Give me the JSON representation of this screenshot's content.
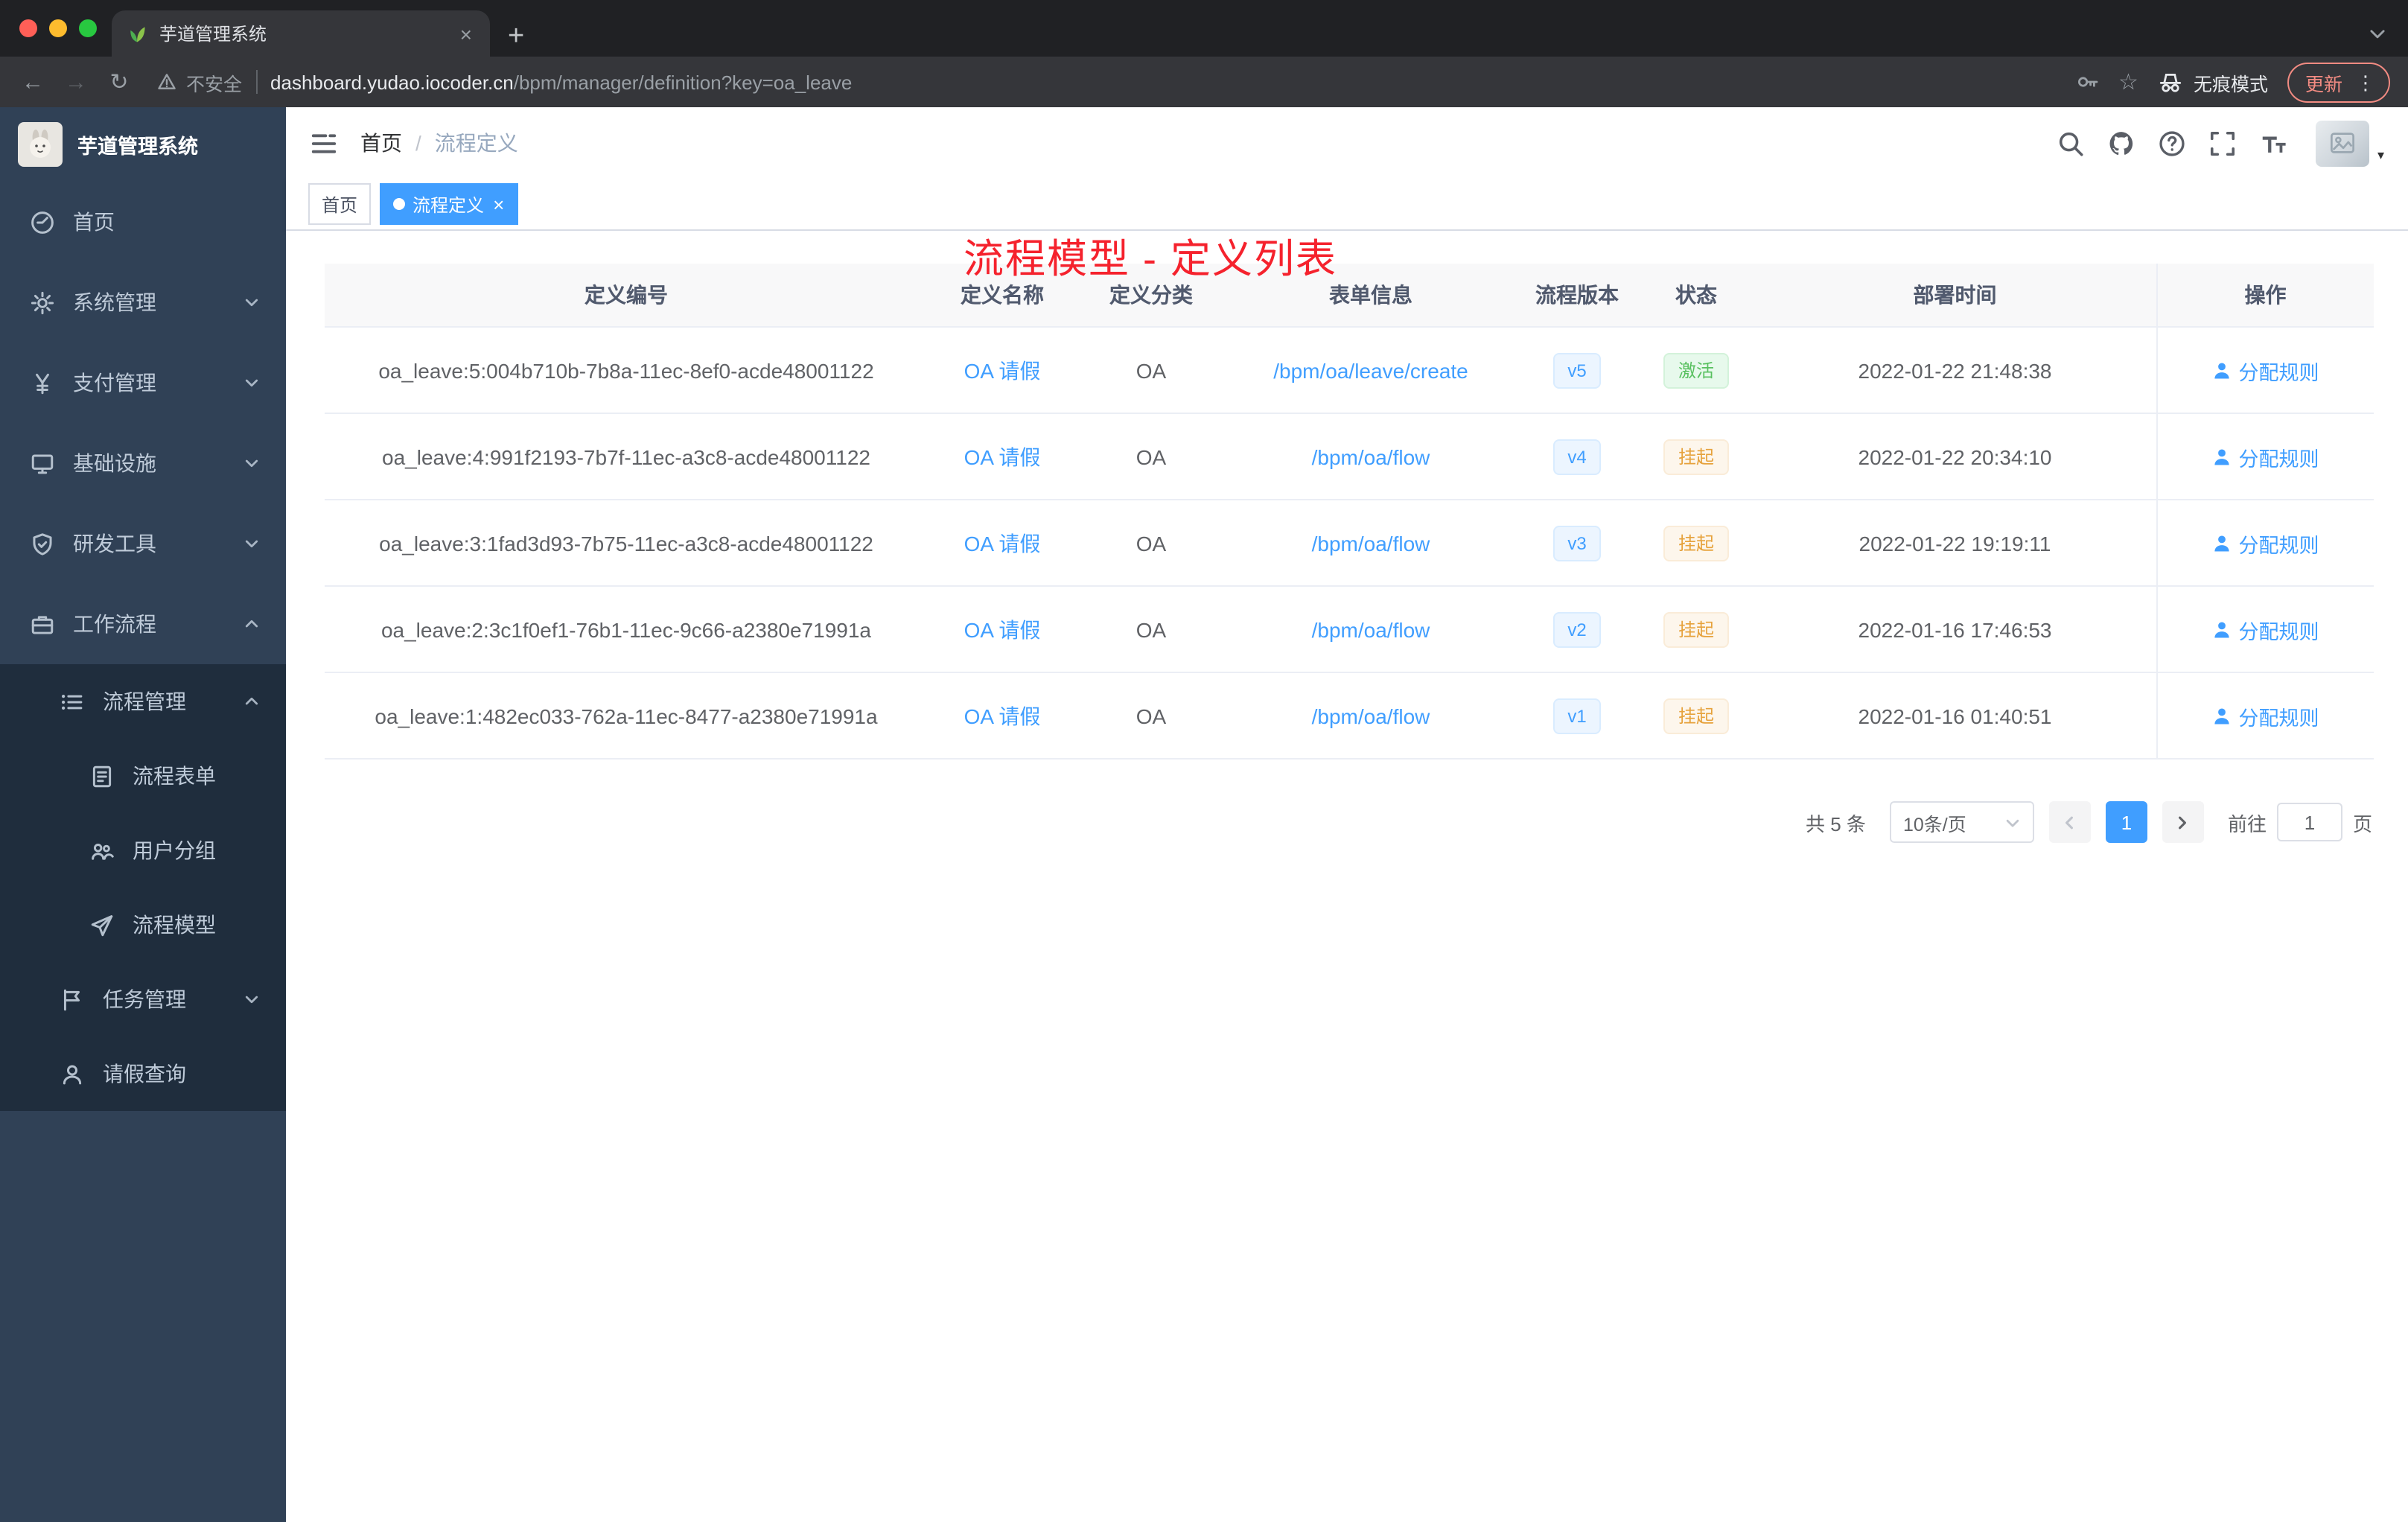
{
  "browser": {
    "tab_title": "芋道管理系统",
    "url_domain": "dashboard.yudao.iocoder.cn",
    "url_path": "/bpm/manager/definition?key=oa_leave",
    "security_label": "不安全",
    "incognito_label": "无痕模式",
    "update_label": "更新"
  },
  "icons": {
    "close": "×",
    "plus": "+",
    "dots_vertical": "⋮",
    "caret_down": "▾",
    "back_arrow": "←",
    "forward_arrow": "→",
    "reload": "↻",
    "star": "☆",
    "breadcrumb_separator": "/"
  },
  "sidebar": {
    "logo_title": "芋道管理系统",
    "items": [
      {
        "key": "home",
        "label": "首页",
        "icon": "dashboard-icon",
        "level": 1
      },
      {
        "key": "system",
        "label": "系统管理",
        "icon": "gear-icon",
        "level": 1,
        "chevron": "down"
      },
      {
        "key": "payment",
        "label": "支付管理",
        "icon": "yen-icon",
        "level": 1,
        "chevron": "down"
      },
      {
        "key": "infrastructure",
        "label": "基础设施",
        "icon": "monitor-icon",
        "level": 1,
        "chevron": "down"
      },
      {
        "key": "dev-tools",
        "label": "研发工具",
        "icon": "shield-icon",
        "level": 1,
        "chevron": "down"
      },
      {
        "key": "workflow",
        "label": "工作流程",
        "icon": "briefcase-icon",
        "level": 1,
        "chevron": "up"
      },
      {
        "key": "process-mgmt",
        "label": "流程管理",
        "icon": "list-icon",
        "level": 2,
        "chevron": "up"
      },
      {
        "key": "process-form",
        "label": "流程表单",
        "icon": "form-icon",
        "level": 3
      },
      {
        "key": "user-group",
        "label": "用户分组",
        "icon": "group-icon",
        "level": 3
      },
      {
        "key": "process-model",
        "label": "流程模型",
        "icon": "send-icon",
        "level": 3
      },
      {
        "key": "task-mgmt",
        "label": "任务管理",
        "icon": "flag-icon",
        "level": 2,
        "chevron": "down"
      },
      {
        "key": "leave-query",
        "label": "请假查询",
        "icon": "user-icon",
        "level": 2
      }
    ]
  },
  "header": {
    "breadcrumb": [
      "首页",
      "流程定义"
    ],
    "overlay_title": "流程模型 - 定义列表"
  },
  "tags": [
    {
      "key": "home",
      "label": "首页",
      "active": false,
      "closable": false
    },
    {
      "key": "process-definition",
      "label": "流程定义",
      "active": true,
      "closable": true
    }
  ],
  "table": {
    "columns": [
      "定义编号",
      "定义名称",
      "定义分类",
      "表单信息",
      "流程版本",
      "状态",
      "部署时间",
      "操作"
    ],
    "rows": [
      {
        "id": "oa_leave:5:004b710b-7b8a-11ec-8ef0-acde48001122",
        "name": "OA 请假",
        "category": "OA",
        "form": "/bpm/oa/leave/create",
        "version": "v5",
        "status": "激活",
        "status_type": "success",
        "deploy_time": "2022-01-22 21:48:38",
        "action": "分配规则"
      },
      {
        "id": "oa_leave:4:991f2193-7b7f-11ec-a3c8-acde48001122",
        "name": "OA 请假",
        "category": "OA",
        "form": "/bpm/oa/flow",
        "version": "v4",
        "status": "挂起",
        "status_type": "warning",
        "deploy_time": "2022-01-22 20:34:10",
        "action": "分配规则"
      },
      {
        "id": "oa_leave:3:1fad3d93-7b75-11ec-a3c8-acde48001122",
        "name": "OA 请假",
        "category": "OA",
        "form": "/bpm/oa/flow",
        "version": "v3",
        "status": "挂起",
        "status_type": "warning",
        "deploy_time": "2022-01-22 19:19:11",
        "action": "分配规则"
      },
      {
        "id": "oa_leave:2:3c1f0ef1-76b1-11ec-9c66-a2380e71991a",
        "name": "OA 请假",
        "category": "OA",
        "form": "/bpm/oa/flow",
        "version": "v2",
        "status": "挂起",
        "status_type": "warning",
        "deploy_time": "2022-01-16 17:46:53",
        "action": "分配规则"
      },
      {
        "id": "oa_leave:1:482ec033-762a-11ec-8477-a2380e71991a",
        "name": "OA 请假",
        "category": "OA",
        "form": "/bpm/oa/flow",
        "version": "v1",
        "status": "挂起",
        "status_type": "warning",
        "deploy_time": "2022-01-16 01:40:51",
        "action": "分配规则"
      }
    ]
  },
  "pagination": {
    "total_label": "共 5 条",
    "page_size": "10条/页",
    "current_page": "1",
    "goto_label": "前往",
    "goto_value": "1",
    "page_unit": "页"
  },
  "colors": {
    "primary": "#409eff",
    "success": "#58c05f",
    "warning": "#e6a23c",
    "annotation_red": "#f5222d",
    "sidebar_bg": "#304156",
    "submenu_bg": "#1f2d3d"
  }
}
